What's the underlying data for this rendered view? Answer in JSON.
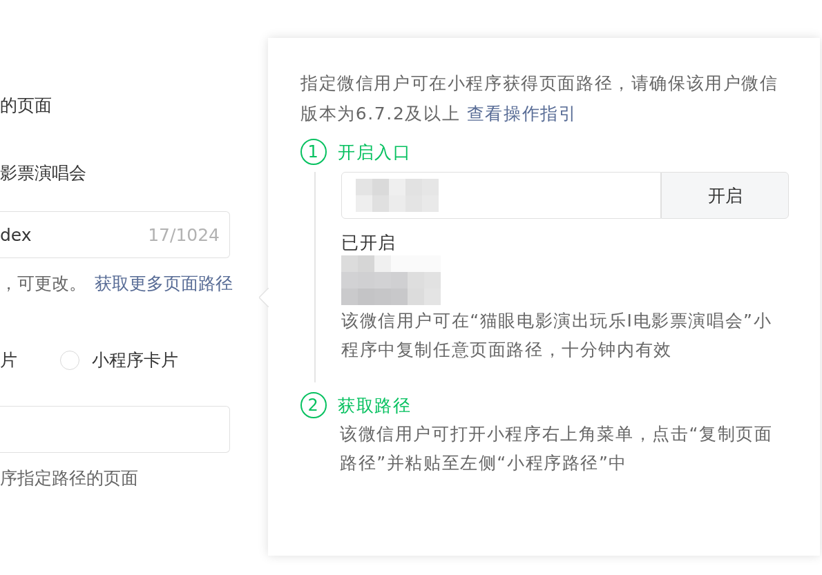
{
  "form": {
    "line_1": "的页面",
    "line_2": "影票演唱会",
    "path_field": {
      "value": "dex",
      "counter": "17/1024"
    },
    "hint": {
      "text": "，可更改。",
      "link": "获取更多页面路径"
    },
    "option_text": "片",
    "radios": [
      {
        "label": "小程序卡片",
        "selected": false
      }
    ],
    "note": "序指定路径的页面"
  },
  "popover": {
    "intro": "指定微信用户可在小程序获得页面路径，请确保该用户微信版本为6.7.2及以上",
    "guide_link": "查看操作指引",
    "steps": [
      {
        "kind": "enable",
        "number": "1",
        "title": "开启入口",
        "button": "开启",
        "status": "已开启",
        "description": "该微信用户可在“猫眼电影演出玩乐I电影票演唱会”小程序中复制任意页面路径，十分钟内有效"
      },
      {
        "kind": "info",
        "number": "2",
        "title": "获取路径",
        "description": "该微信用户可打开小程序右上角菜单，点击“复制页面路径”并粘贴至左侧“小程序路径”中"
      }
    ]
  }
}
